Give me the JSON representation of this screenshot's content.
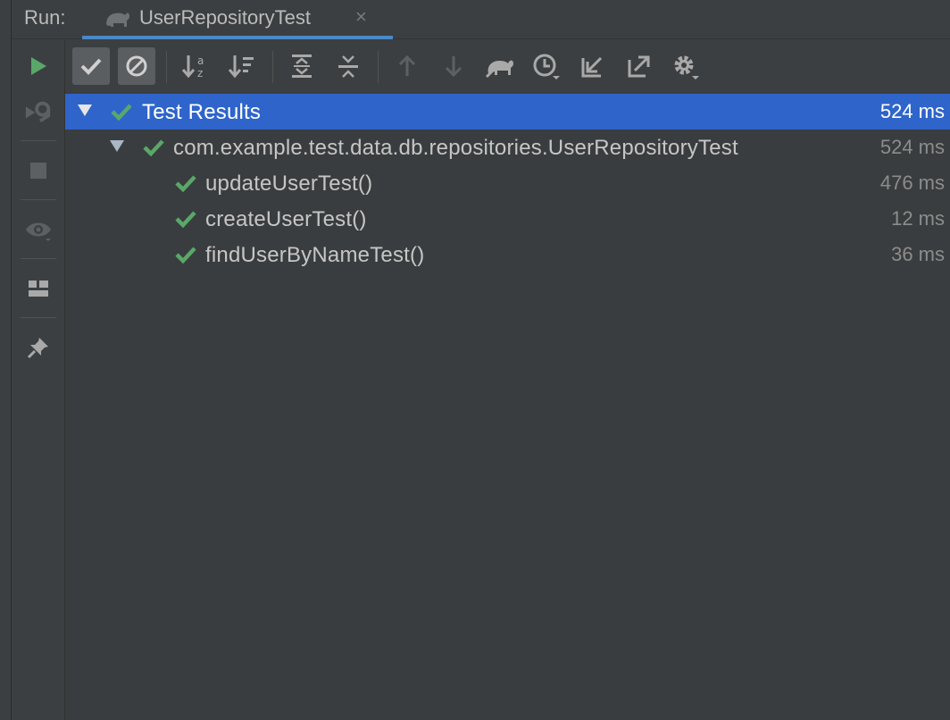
{
  "header": {
    "run_label": "Run:",
    "tab_title": "UserRepositoryTest",
    "tab_close": "×",
    "tab_icon": "gradle-elephant-icon"
  },
  "side_toolbar": {
    "items": [
      "run-icon",
      "rerun-failed-icon",
      "stop-icon",
      "watch-icon",
      "layout-icon",
      "pin-icon"
    ]
  },
  "toolbar": {
    "items": [
      "show-passed-icon",
      "show-ignored-icon",
      "sort-alpha-icon",
      "sort-duration-icon",
      "expand-all-icon",
      "collapse-all-icon",
      "prev-failed-icon",
      "next-failed-icon",
      "gradle-icon",
      "test-history-icon",
      "import-tests-icon",
      "export-tests-icon",
      "settings-icon"
    ]
  },
  "tree": {
    "root": {
      "label": "Test Results",
      "time": "524 ms",
      "status": "passed"
    },
    "suite": {
      "label": "com.example.test.data.db.repositories.UserRepositoryTest",
      "time": "524 ms",
      "status": "passed"
    },
    "tests": [
      {
        "label": "updateUserTest()",
        "time": "476 ms",
        "status": "passed"
      },
      {
        "label": "createUserTest()",
        "time": "12 ms",
        "status": "passed"
      },
      {
        "label": "findUserByNameTest()",
        "time": "36 ms",
        "status": "passed"
      }
    ]
  },
  "colors": {
    "background": "#3c3f41",
    "selection": "#2f65ca",
    "passed": "#59a869",
    "accent": "#4a88c7"
  }
}
